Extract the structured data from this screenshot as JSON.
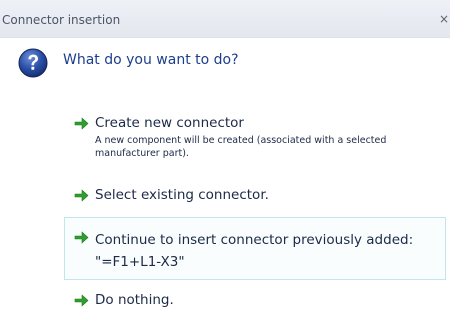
{
  "window": {
    "title": "Connector insertion",
    "close_glyph": "×"
  },
  "header": {
    "icon": "help-question-icon",
    "question": "What do you want to do?"
  },
  "options": [
    {
      "icon": "green-arrow-right-icon",
      "label": "Create new connector",
      "description": "A new component will be created (associated with a selected manufacturer part)."
    },
    {
      "icon": "green-arrow-right-icon",
      "label": "Select existing connector."
    },
    {
      "icon": "green-arrow-right-icon",
      "label_line1": "Continue to insert connector previously added:",
      "label_line2": "\"=F1+L1-X3\"",
      "highlighted": true
    },
    {
      "icon": "green-arrow-right-icon",
      "label": "Do nothing."
    }
  ],
  "colors": {
    "accent": "#1d3e8e",
    "arrow": "#2f9e2f",
    "highlight_border": "#bfe6f1"
  }
}
